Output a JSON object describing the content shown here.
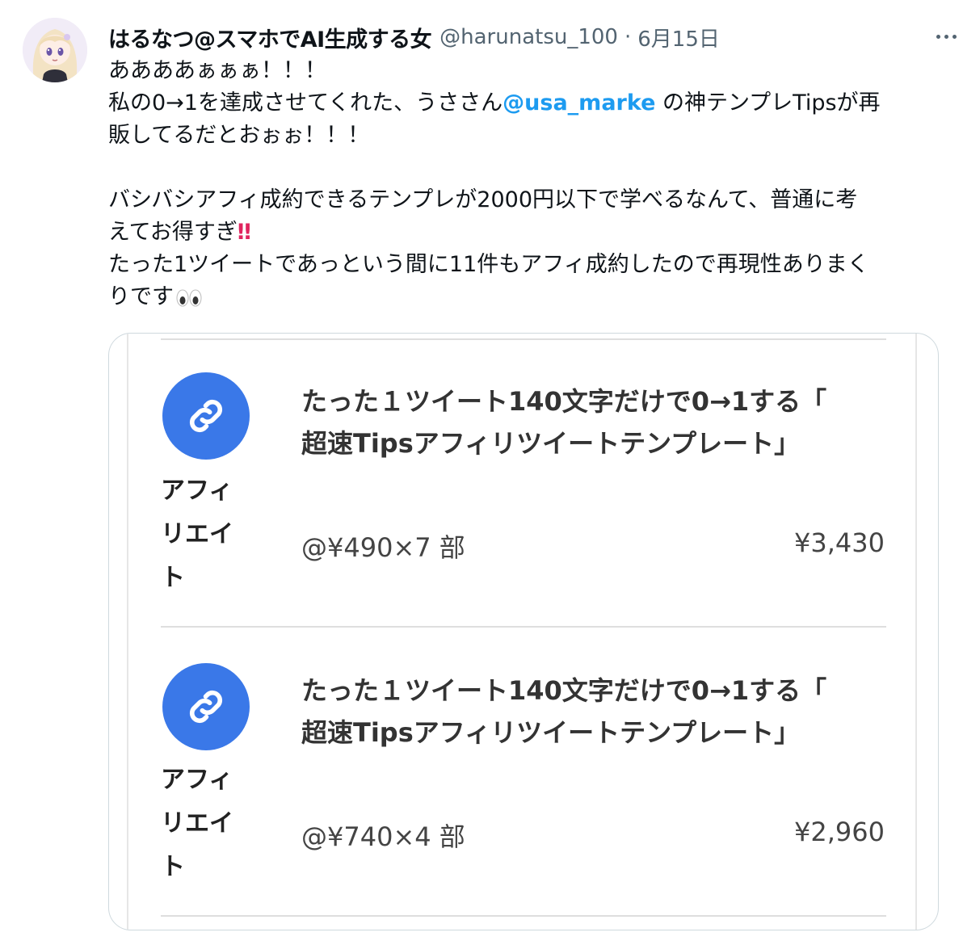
{
  "tweet": {
    "author": {
      "display_name": "はるなつ@スマホでAI生成する女",
      "handle": "@harunatsu_100"
    },
    "separator": "·",
    "date": "6月15日",
    "text": {
      "line1": "ああああぁぁぁ！！！",
      "line2_before": "私の0→1を達成させてくれた、うささん",
      "mention": "@usa_marke",
      "line2_after": " の神テンプレTipsが再",
      "line3": "販してるだとおぉぉ！！！",
      "line4": "バシバシアフィ成約できるテンプレが2000円以下で学べるなんて、普通に考",
      "line5_before": "えてお得すぎ",
      "line5_emoji": "‼",
      "line6": "たった1ツイートであっという間に11件もアフィ成約したので再現性ありまく",
      "line7": "りです"
    }
  },
  "media": {
    "rows": [
      {
        "icon": "link-icon",
        "category_lines": [
          "アフィ",
          "リエイ",
          "ト"
        ],
        "title_line1": "たった１ツイート140文字だけで0→1する「",
        "title_line2": "超速Tipsアフィリツイートテンプレート」",
        "unit_info": "@¥490×7 部",
        "amount": "¥3,430"
      },
      {
        "icon": "link-icon",
        "category_lines": [
          "アフィ",
          "リエイ",
          "ト"
        ],
        "title_line1": "たった１ツイート140文字だけで0→1する「",
        "title_line2": "超速Tipsアフィリツイートテンプレート」",
        "unit_info": "@¥740×4 部",
        "amount": "¥2,960"
      }
    ]
  },
  "colors": {
    "link_blue": "#1d9bf0",
    "icon_blue": "#3a78e8",
    "secondary_text": "#536471"
  }
}
